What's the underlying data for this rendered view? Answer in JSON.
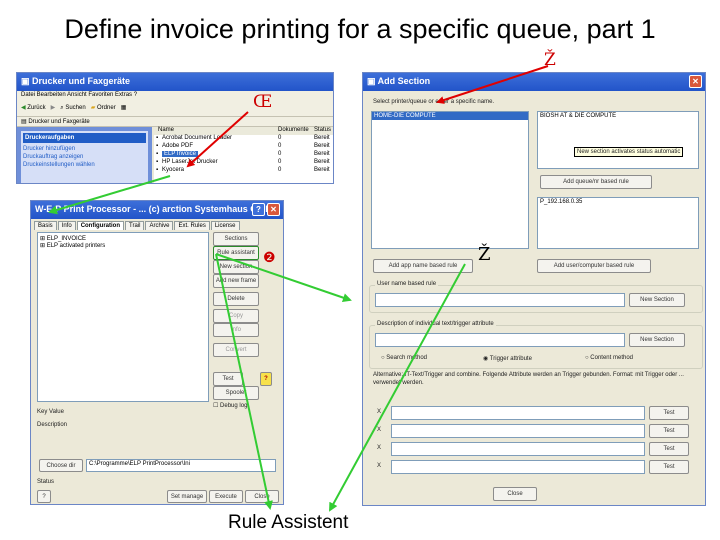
{
  "slide": {
    "title": "Define invoice printing for a specific queue, part 1",
    "caption": "Rule Assistent",
    "markers": {
      "one": "Œ",
      "two": "❷",
      "three": "Ž"
    },
    "colors": {
      "arrow_red": "#e00000",
      "arrow_green": "#33cc33"
    }
  },
  "explorer": {
    "title": "Drucker und Faxgeräte",
    "menu": "Datei  Bearbeiten  Ansicht  Favoriten  Extras  ?",
    "toolbar": {
      "back": "Zurück",
      "search": "Suchen",
      "folders": "Ordner"
    },
    "address": "Drucker und Faxgeräte",
    "task_header": "Druckeraufgaben",
    "tasks": [
      "Drucker hinzufügen",
      "Druckauftrag anzeigen",
      "Druckeinstellungen wählen"
    ],
    "columns": {
      "name": "Name",
      "docs": "Dokumente",
      "status": "Status"
    },
    "printers": [
      {
        "name": "Acrobat Document Loader",
        "docs": "0",
        "status": "Bereit",
        "selected": false
      },
      {
        "name": "Adobe PDF",
        "docs": "0",
        "status": "Bereit",
        "selected": false
      },
      {
        "name": "ELP Invoice",
        "docs": "0",
        "status": "Bereit",
        "selected": true
      },
      {
        "name": "HP LaserJet Drucker",
        "docs": "0",
        "status": "Bereit",
        "selected": false
      },
      {
        "name": "Kyocera",
        "docs": "0",
        "status": "Bereit",
        "selected": false
      }
    ]
  },
  "props": {
    "title": "W-E-P Print Processor - ... (c) arction Systemhaus GmbH",
    "tabs": [
      "Basis",
      "Info",
      "Configuration",
      "Trail",
      "Archive",
      "Ext. Rules",
      "License"
    ],
    "active_tab": "Configuration",
    "tree": [
      "ELP_INVOICE",
      "ELP activated printers"
    ],
    "buttons": [
      "Sections",
      "Rule assistant",
      "New section",
      "Add new frame",
      "Delete",
      "Copy",
      "Info",
      "Convert",
      "Test",
      "Spooler"
    ],
    "help_button": "?",
    "checkbox_label": "Debug log",
    "key_value_label": "Key Value",
    "key_value": "Description",
    "path_button": "Choose dir",
    "path_value": "C:\\Programme\\ELP PrintProcessor\\Ini",
    "footer_label": "Status",
    "bottom_buttons": [
      "?",
      "Set manage",
      "Execute",
      "Close"
    ]
  },
  "add_section": {
    "title": "Add Section",
    "instruction": "Select printer/queue or enter a specific name.",
    "queue_selected": "HOME-DIE COMPUTE",
    "right_field_value": "BIOSH AT & DIE COMPUTE",
    "tooltip": "New section activates status automatic",
    "info_button": "Add queue/nr based rule",
    "ip_value": "P_192.168.0.35",
    "add_name_button": "Add app name based rule",
    "add_user_button": "Add user/computer based rule",
    "group1_label": "User name based rule",
    "group1_button": "New Section",
    "group2_label": "Description of individual text/trigger attribute",
    "group2_button": "New Section",
    "radios": [
      {
        "label": "Search method",
        "checked": false
      },
      {
        "label": "Trigger attribute",
        "checked": true
      },
      {
        "label": "Content method",
        "checked": false
      }
    ],
    "note": "Alternative: IT-Text/Trigger and combine. Folgende Attribute werden an Trigger gebunden. Format: mit Trigger oder ... verwendet werden.",
    "rows": [
      {
        "label": "X",
        "button": "Test"
      },
      {
        "label": "X",
        "button": "Test"
      },
      {
        "label": "X",
        "button": "Test"
      },
      {
        "label": "X",
        "button": "Test"
      }
    ],
    "close_button": "Close"
  }
}
